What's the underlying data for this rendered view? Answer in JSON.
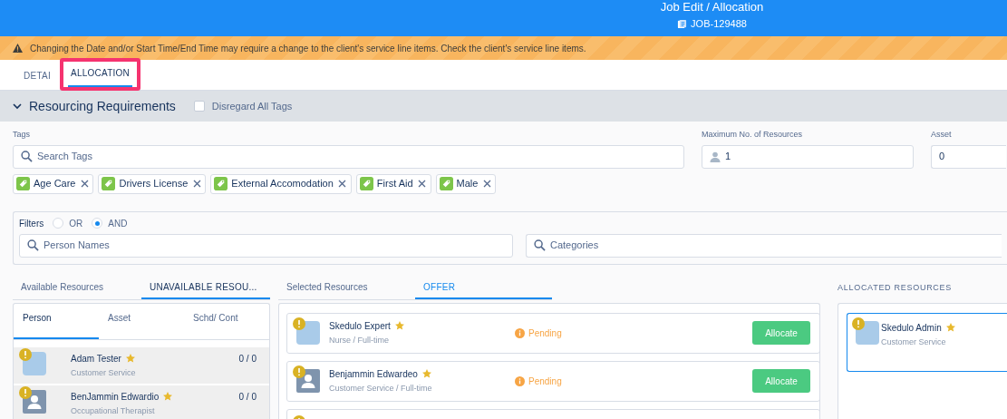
{
  "header": {
    "title": "Job Edit / Allocation",
    "job_number": "JOB-129488"
  },
  "warning": "Changing the Date and/or Start Time/End Time may require a change to the client's service line items. Check the client's service line items.",
  "tabs": [
    {
      "label": "DETAI",
      "selected": false
    },
    {
      "label": "ALLOCATION",
      "selected": true
    }
  ],
  "requirements": {
    "title": "Resourcing Requirements",
    "expanded": true,
    "disregard_label": "Disregard All Tags",
    "disregard_checked": false,
    "tags_label": "Tags",
    "tags_placeholder": "Search Tags",
    "max_label": "Maximum No. of Resources",
    "max_value": "1",
    "asset_label": "Asset",
    "asset_value": "0",
    "tags": [
      "Age Care",
      "Drivers License",
      "External Accomodation",
      "First Aid",
      "Male"
    ],
    "filters_label": "Filters",
    "filter_options": [
      {
        "label": "OR",
        "selected": false
      },
      {
        "label": "AND",
        "selected": true
      }
    ],
    "person_placeholder": "Person Names",
    "categories_placeholder": "Categories"
  },
  "resource_tabs": [
    {
      "label": "Available Resources",
      "selected": false
    },
    {
      "label": "UNAVAILABLE RESOU...",
      "selected": true
    }
  ],
  "sub_tabs": [
    {
      "label": "Person",
      "selected": true
    },
    {
      "label": "Asset",
      "selected": false
    },
    {
      "label": "Schd/ Cont",
      "selected": false
    }
  ],
  "resources": [
    {
      "name": "Adam Tester",
      "role": "Customer Service",
      "count": "0 / 0",
      "kind": "photo",
      "warning": true,
      "starred": true
    },
    {
      "name": "BenJammin Edwardio",
      "role": "Occupational Therapist",
      "count": "0 / 0",
      "kind": "silhouette",
      "warning": true,
      "starred": true
    }
  ],
  "selected_tabs": [
    {
      "label": "Selected Resources",
      "selected": false
    },
    {
      "label": "OFFER",
      "selected": true
    }
  ],
  "offers": [
    {
      "name": "Skedulo Expert",
      "detail": "Nurse / Full-time",
      "status": "Pending",
      "action": "Allocate",
      "kind": "photo",
      "warning": true,
      "starred": true
    },
    {
      "name": "Benjammin Edwardeo",
      "detail": "Customer Service / Full-time",
      "status": "Pending",
      "action": "Allocate",
      "kind": "silhouette",
      "warning": true,
      "starred": true
    }
  ],
  "allocated": {
    "title": "ALLOCATED RESOURCES",
    "items": [
      {
        "name": "Skedulo Admin",
        "role": "Customer Service",
        "kind": "photo",
        "warning": true,
        "starred": true
      }
    ]
  }
}
